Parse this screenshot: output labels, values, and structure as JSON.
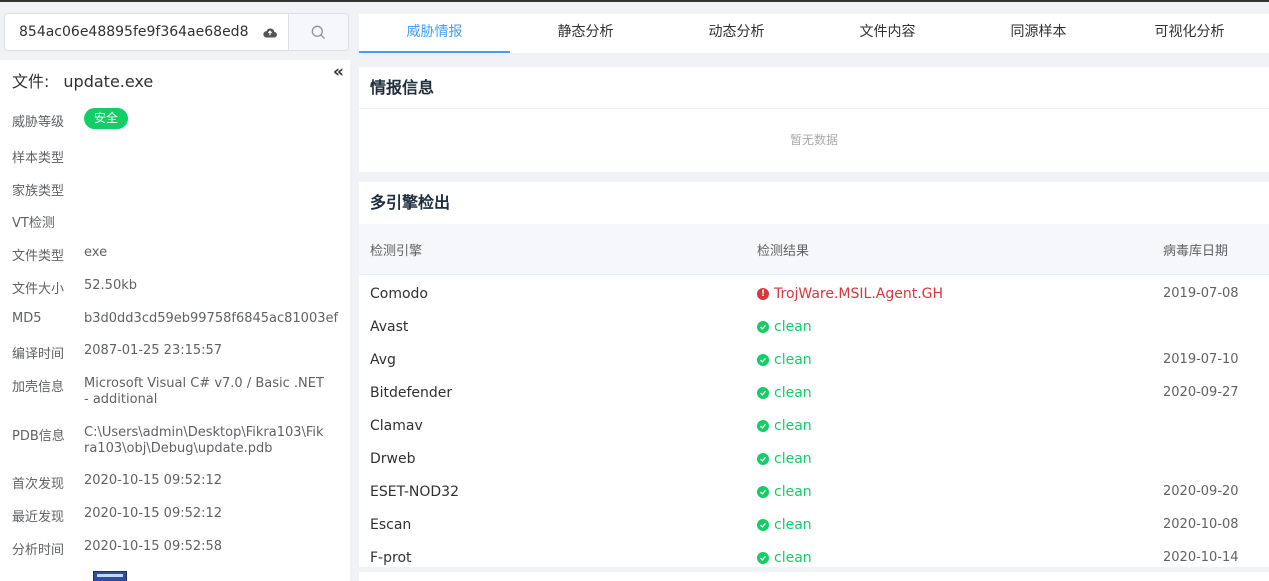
{
  "search": {
    "hash": "854ac06e48895fe9f364ae68ed8"
  },
  "file": {
    "title_label": "文件:",
    "name": "update.exe",
    "collapse": "«",
    "threat_level_label": "威胁等级",
    "threat_level_value": "安全",
    "fields": [
      {
        "label": "样本类型",
        "value": ""
      },
      {
        "label": "家族类型",
        "value": ""
      },
      {
        "label": "VT检测",
        "value": ""
      },
      {
        "label": "文件类型",
        "value": "exe"
      },
      {
        "label": "文件大小",
        "value": "52.50kb"
      },
      {
        "label": "MD5",
        "value": "b3d0dd3cd59eb99758f6845ac81003ef"
      },
      {
        "label": "编译时间",
        "value": "2087-01-25 23:15:57"
      },
      {
        "label": "加壳信息",
        "value": "Microsoft Visual C# v7.0 / Basic .NET - additional"
      },
      {
        "label": "PDB信息",
        "value": "C:\\Users\\admin\\Desktop\\Fikra103\\Fikra103\\obj\\Debug\\update.pdb"
      },
      {
        "label": "首次发现",
        "value": "2020-10-15 09:52:12"
      },
      {
        "label": "最近发现",
        "value": "2020-10-15 09:52:12"
      },
      {
        "label": "分析时间",
        "value": "2020-10-15 09:52:58"
      }
    ]
  },
  "tabs": [
    "威胁情报",
    "静态分析",
    "动态分析",
    "文件内容",
    "同源样本",
    "可视化分析"
  ],
  "intel": {
    "title": "情报信息",
    "empty": "暂无数据"
  },
  "engines": {
    "title": "多引擎检出",
    "headers": [
      "检测引擎",
      "检测结果",
      "病毒库日期"
    ],
    "rows": [
      {
        "engine": "Comodo",
        "result": "TrojWare.MSIL.Agent.GH",
        "status": "bad",
        "date": "2019-07-08"
      },
      {
        "engine": "Avast",
        "result": "clean",
        "status": "ok",
        "date": ""
      },
      {
        "engine": "Avg",
        "result": "clean",
        "status": "ok",
        "date": "2019-07-10"
      },
      {
        "engine": "Bitdefender",
        "result": "clean",
        "status": "ok",
        "date": "2020-09-27"
      },
      {
        "engine": "Clamav",
        "result": "clean",
        "status": "ok",
        "date": ""
      },
      {
        "engine": "Drweb",
        "result": "clean",
        "status": "ok",
        "date": ""
      },
      {
        "engine": "ESET-NOD32",
        "result": "clean",
        "status": "ok",
        "date": "2020-09-20"
      },
      {
        "engine": "Escan",
        "result": "clean",
        "status": "ok",
        "date": "2020-10-08"
      },
      {
        "engine": "F-prot",
        "result": "clean",
        "status": "ok",
        "date": "2020-10-14"
      }
    ]
  },
  "colors": {
    "accent": "#409eff",
    "safe": "#13ce66",
    "danger": "#d9363e"
  }
}
